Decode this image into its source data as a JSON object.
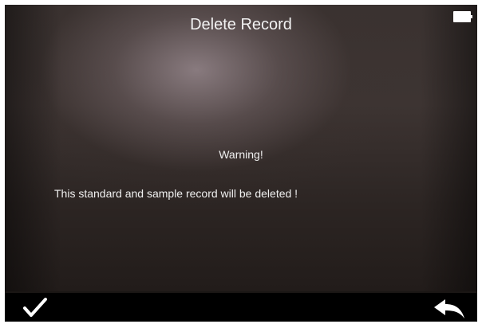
{
  "header": {
    "title": "Delete Record",
    "battery_icon": "battery-full-icon"
  },
  "dialog": {
    "warning_title": "Warning!",
    "warning_message": "This standard and sample record will be deleted !"
  },
  "bottom_bar": {
    "confirm_icon": "checkmark-icon",
    "back_icon": "back-arrow-icon"
  },
  "colors": {
    "background": "#2c2523",
    "text": "#f0f0f0",
    "bottom_bar": "#000000"
  }
}
